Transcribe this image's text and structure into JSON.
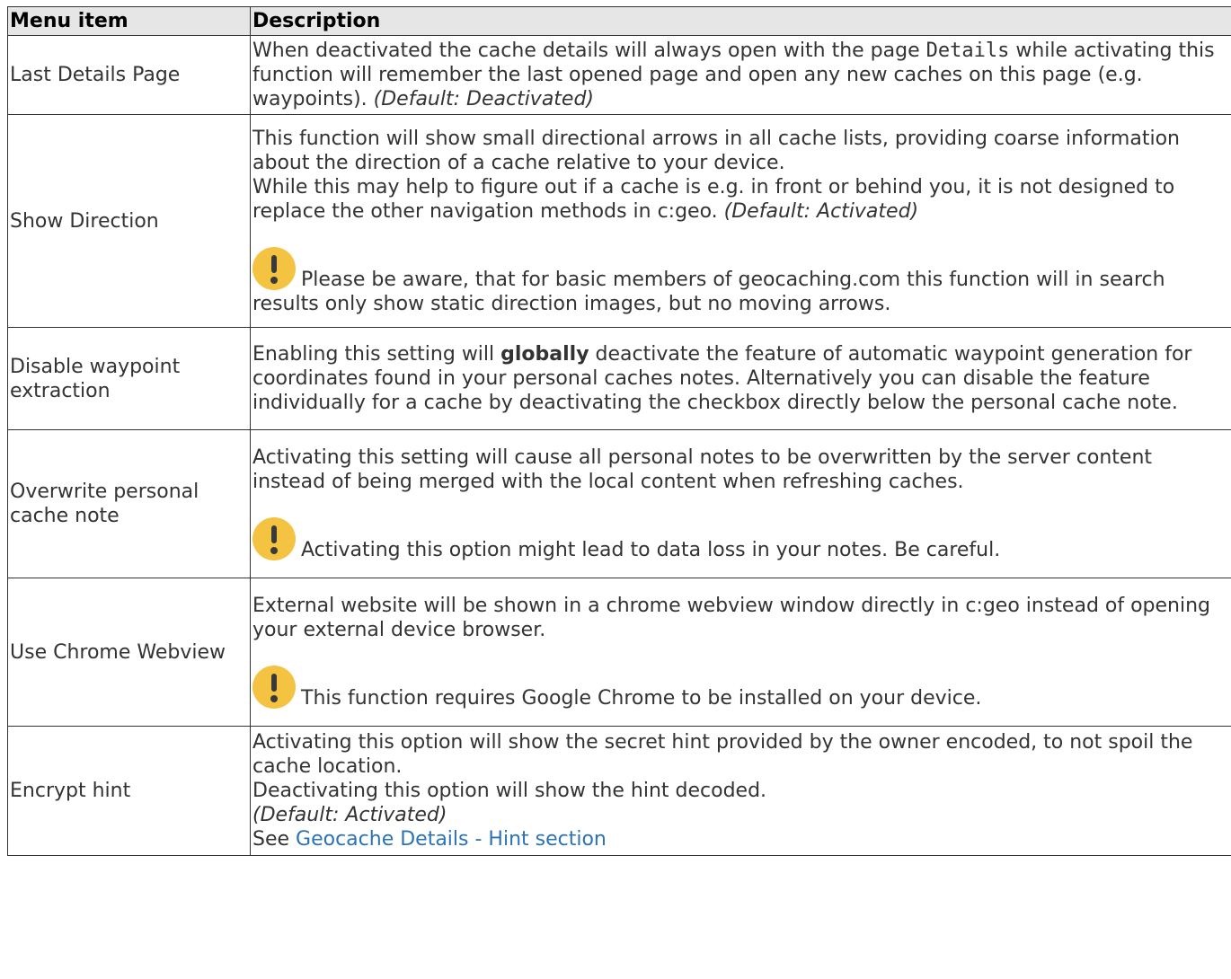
{
  "table": {
    "headers": [
      "Menu item",
      "Description"
    ],
    "rows": [
      {
        "item": "Last Details Page",
        "d_a": "When deactivated the cache details will always open with the page ",
        "d_code": "Details",
        "d_b": " while activating this function will remember the last opened page and open any new caches on this page (e.g. waypoints). ",
        "d_default": "(Default: Deactivated)"
      },
      {
        "item": "Show Direction",
        "p1": "This function will show small directional arrows in all cache lists, providing coarse information about the direction of a cache relative to your device.",
        "p2": "While this may help to figure out if a cache is e.g. in front or behind you, it is not designed to replace the other navigation methods in c:geo. ",
        "p2_default": "(Default: Activated)",
        "note": "Please be aware, that for basic members of geocaching.com this function will in search results only show static direction images, but no moving arrows."
      },
      {
        "item": "Disable waypoint extraction",
        "d_a": "Enabling this setting will ",
        "d_strong": "globally",
        "d_b": " deactivate the feature of automatic waypoint generation for coordinates found in your personal caches notes. Alternatively you can disable the feature individually for a cache by deactivating the checkbox directly below the personal cache note."
      },
      {
        "item": "Overwrite personal cache note",
        "p1": "Activating this setting will cause all personal notes to be overwritten by the server content instead of being merged with the local content when refreshing caches.",
        "note": "Activating this option might lead to data loss in your notes. Be careful."
      },
      {
        "item": "Use Chrome Webview",
        "p1": "External website will be shown in a chrome webview window directly in c:geo instead of opening your external device browser.",
        "note": "This function requires Google Chrome to be installed on your device."
      },
      {
        "item": "Encrypt hint",
        "l1": "Activating this option will show the secret hint provided by the owner encoded, to not spoil the cache location.",
        "l2": "Deactivating this option will show the hint decoded.",
        "l3": "(Default: Activated)",
        "l4_prefix": "See ",
        "l4_link": "Geocache Details - Hint section"
      }
    ]
  },
  "icons": {
    "warning": "exclamation-warning-icon"
  },
  "colors": {
    "warning": "#f5c342",
    "link": "#2b73b7",
    "header_bg": "#e6e6e6"
  }
}
